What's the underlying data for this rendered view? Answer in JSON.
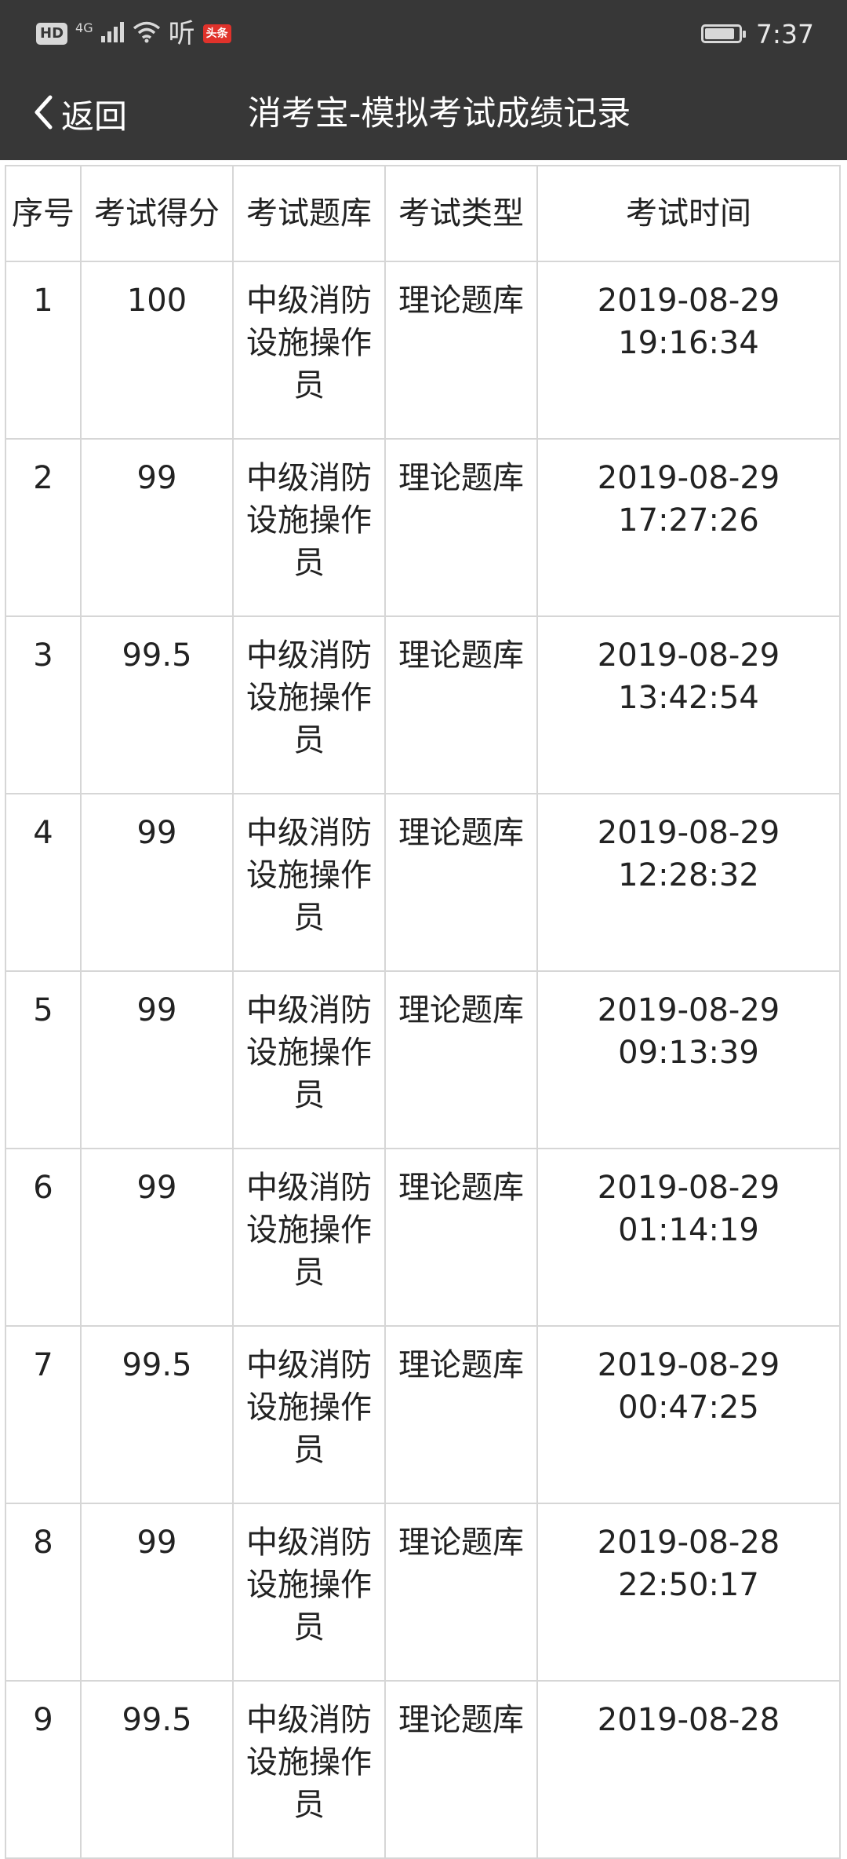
{
  "status_bar": {
    "hd": "HD",
    "network": "4G",
    "listen": "听",
    "news_badge": "头条",
    "time": "7:37",
    "battery_level": 0.9
  },
  "nav": {
    "back_label": "返回",
    "title": "消考宝-模拟考试成绩记录",
    "back_icon": "chevron-left-icon"
  },
  "table": {
    "headers": [
      "序号",
      "考试得分",
      "考试题库",
      "考试类型",
      "考试时间"
    ],
    "rows": [
      {
        "no": "1",
        "score": "100",
        "bank": "中级消防设施操作员",
        "type": "理论题库",
        "date": "2019-08-29",
        "time": "19:16:34"
      },
      {
        "no": "2",
        "score": "99",
        "bank": "中级消防设施操作员",
        "type": "理论题库",
        "date": "2019-08-29",
        "time": "17:27:26"
      },
      {
        "no": "3",
        "score": "99.5",
        "bank": "中级消防设施操作员",
        "type": "理论题库",
        "date": "2019-08-29",
        "time": "13:42:54"
      },
      {
        "no": "4",
        "score": "99",
        "bank": "中级消防设施操作员",
        "type": "理论题库",
        "date": "2019-08-29",
        "time": "12:28:32"
      },
      {
        "no": "5",
        "score": "99",
        "bank": "中级消防设施操作员",
        "type": "理论题库",
        "date": "2019-08-29",
        "time": "09:13:39"
      },
      {
        "no": "6",
        "score": "99",
        "bank": "中级消防设施操作员",
        "type": "理论题库",
        "date": "2019-08-29",
        "time": "01:14:19"
      },
      {
        "no": "7",
        "score": "99.5",
        "bank": "中级消防设施操作员",
        "type": "理论题库",
        "date": "2019-08-29",
        "time": "00:47:25"
      },
      {
        "no": "8",
        "score": "99",
        "bank": "中级消防设施操作员",
        "type": "理论题库",
        "date": "2019-08-28",
        "time": "22:50:17"
      },
      {
        "no": "9",
        "score": "99.5",
        "bank": "中级消防设施操作员",
        "type": "理论题库",
        "date": "2019-08-28",
        "time": ""
      }
    ]
  },
  "colors": {
    "bar_background": "#373737",
    "grid_border": "#d6d6d6",
    "text": "#222222"
  }
}
